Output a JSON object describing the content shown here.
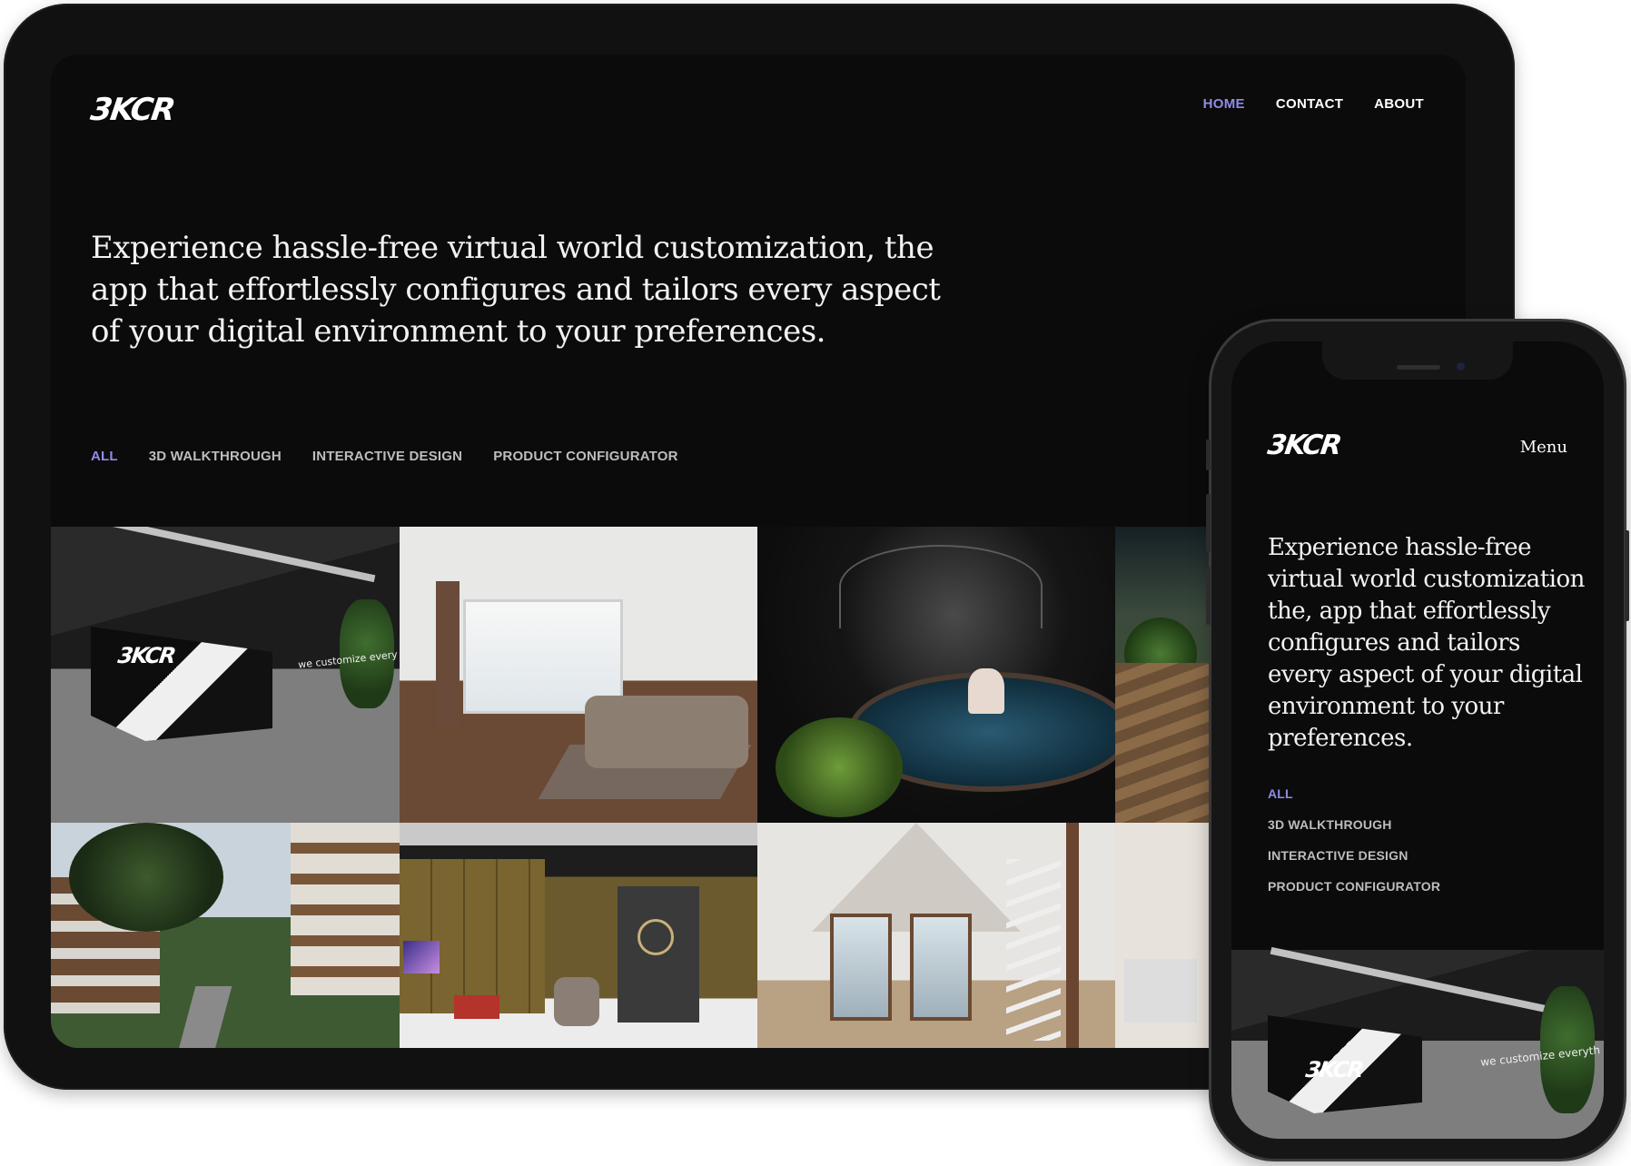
{
  "brand": {
    "logo_text": "3KCR"
  },
  "tablet": {
    "nav": [
      {
        "label": "HOME",
        "active": true
      },
      {
        "label": "CONTACT",
        "active": false
      },
      {
        "label": "ABOUT",
        "active": false
      }
    ],
    "hero_text": "Experience hassle-free virtual world customization, the app that effortlessly configures and tailors every aspect of your digital environment to your preferences.",
    "filters": [
      {
        "label": "ALL",
        "active": true
      },
      {
        "label": "3D WALKTHROUGH",
        "active": false
      },
      {
        "label": "INTERACTIVE DESIGN",
        "active": false
      },
      {
        "label": "PRODUCT CONFIGURATOR",
        "active": false
      }
    ],
    "gallery": [
      {
        "scene": "office-lobby",
        "caption": "we customize every"
      },
      {
        "scene": "living-room"
      },
      {
        "scene": "indoor-pool"
      },
      {
        "scene": "green-lounge"
      },
      {
        "scene": "apartment-exterior"
      },
      {
        "scene": "media-room"
      },
      {
        "scene": "attic-living"
      },
      {
        "scene": "bedroom"
      }
    ]
  },
  "phone": {
    "menu_label": "Menu",
    "hero_text": "Experience hassle-free virtual world customization the, app that effortlessly configures and tailors every aspect of your digital environment to your preferences.",
    "filters": [
      {
        "label": "ALL",
        "active": true
      },
      {
        "label": "3D WALKTHROUGH",
        "active": false
      },
      {
        "label": "INTERACTIVE DESIGN",
        "active": false
      },
      {
        "label": "PRODUCT CONFIGURATOR",
        "active": false
      }
    ],
    "image_caption": "we customize everyth"
  },
  "colors": {
    "accent": "#8f8ce6",
    "background": "#0b0b0b",
    "device_frame": "#111111",
    "text": "#f2f2f2"
  }
}
